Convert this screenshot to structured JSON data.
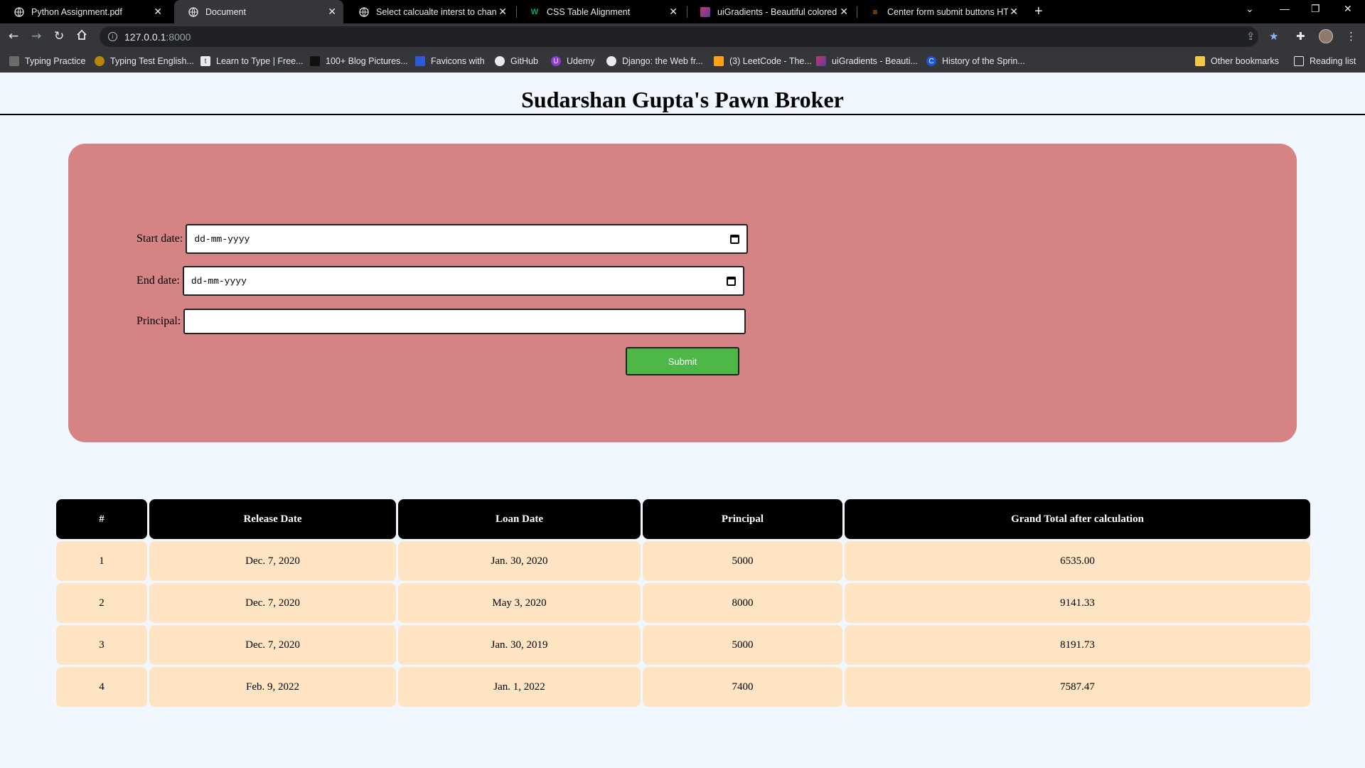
{
  "browser": {
    "tabs": [
      {
        "title": "Python Assignment.pdf",
        "icon": "globe-icon"
      },
      {
        "title": "Document",
        "icon": "globe-icon",
        "active": true
      },
      {
        "title": "Select calcualte interst to change",
        "icon": "globe-icon"
      },
      {
        "title": "CSS Table Alignment",
        "icon": "w3-icon"
      },
      {
        "title": "uiGradients - Beautiful colored g",
        "icon": "uigradients-icon"
      },
      {
        "title": "Center form submit buttons HTM",
        "icon": "stackoverflow-icon"
      }
    ],
    "address": {
      "host": "127.0.0.1",
      "port": ":8000"
    },
    "bookmarks": [
      "Typing Practice",
      "Typing Test English...",
      "Learn to Type | Free...",
      "100+ Blog Pictures...",
      "Favicons with",
      "GitHub",
      "Udemy",
      "Django: the Web fr...",
      "(3) LeetCode - The...",
      "uiGradients - Beauti...",
      "History of the Sprin..."
    ],
    "other_bookmarks": "Other bookmarks",
    "reading_list": "Reading list"
  },
  "page": {
    "title": "Sudarshan Gupta's Pawn Broker",
    "form": {
      "start_label": "Start date:",
      "start_value": "dd-mm-yyyy",
      "end_label": "End date:",
      "end_value": "dd-mm-yyyy",
      "principal_label": "Principal:",
      "principal_value": "",
      "submit_label": "Submit"
    },
    "table": {
      "headers": [
        "#",
        "Release Date",
        "Loan Date",
        "Principal",
        "Grand Total after calculation"
      ],
      "rows": [
        [
          "1",
          "Dec. 7, 2020",
          "Jan. 30, 2020",
          "5000",
          "6535.00"
        ],
        [
          "2",
          "Dec. 7, 2020",
          "May 3, 2020",
          "8000",
          "9141.33"
        ],
        [
          "3",
          "Dec. 7, 2020",
          "Jan. 30, 2019",
          "5000",
          "8191.73"
        ],
        [
          "4",
          "Feb. 9, 2022",
          "Jan. 1, 2022",
          "7400",
          "7587.47"
        ]
      ]
    }
  },
  "colors": {
    "form_bg": "#d58384",
    "submit_bg": "#4db848",
    "header_cell_bg": "#000000",
    "row_cell_bg": "#ffe4c4",
    "page_bg": "#f0f7ff"
  }
}
